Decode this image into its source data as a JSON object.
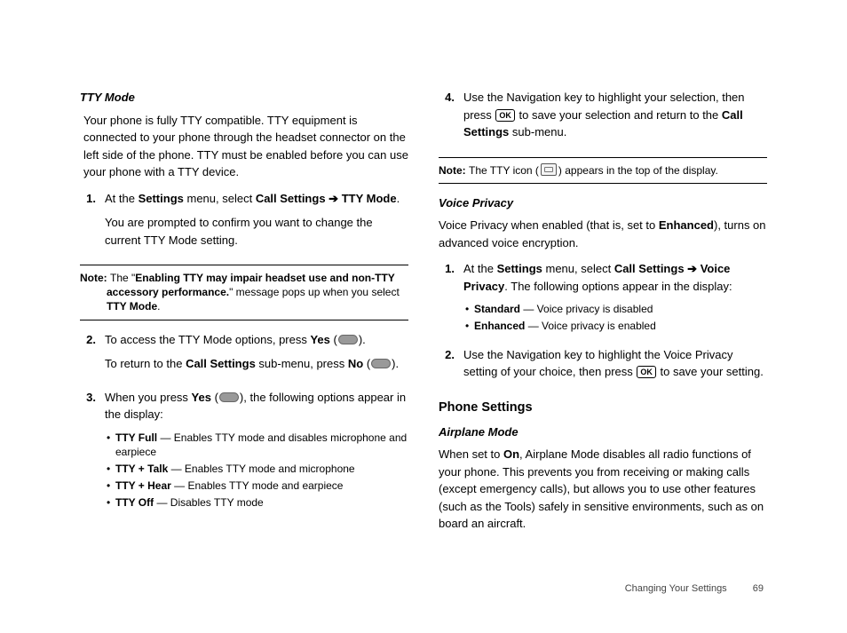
{
  "left": {
    "h_tty": "TTY Mode",
    "p_intro": "Your phone is fully TTY compatible. TTY equipment is connected to your phone through the headset connector on the left side of the phone. TTY must be enabled before you can use your phone with a TTY device.",
    "s1_a": "At the ",
    "s1_b": "Settings",
    "s1_c": " menu, select ",
    "s1_d": "Call Settings",
    "s1_arrow": " ➔ ",
    "s1_e": "TTY Mode",
    "s1_f": ".",
    "s1_line2": "You are prompted to confirm you want to change the current TTY Mode setting.",
    "note1_label": "Note: ",
    "note1_a": "The \"",
    "note1_b": "Enabling TTY may impair headset use and non-TTY accessory performance.",
    "note1_c": "\" message pops up when you select ",
    "note1_d": "TTY Mode",
    "note1_e": ".",
    "s2_a": "To access the TTY Mode options, press ",
    "s2_b": "Yes",
    "s2_c": " (",
    "s2_d": ").",
    "s2_line2_a": "To return to the ",
    "s2_line2_b": "Call Settings",
    "s2_line2_c": " sub-menu, press ",
    "s2_line2_d": "No",
    "s2_line2_e": " (",
    "s2_line2_f": ").",
    "s3_a": "When you press ",
    "s3_b": "Yes",
    "s3_c": " (",
    "s3_d": "), the following options appear in the display:",
    "b1_a": "TTY Full",
    "b1_b": " — Enables TTY mode and disables microphone and earpiece",
    "b2_a": "TTY + Talk",
    "b2_b": " — Enables TTY mode and microphone",
    "b3_a": "TTY + Hear",
    "b3_b": " — Enables TTY mode and earpiece",
    "b4_a": "TTY Off",
    "b4_b": " — Disables TTY mode"
  },
  "right": {
    "s4_a": "Use the Navigation key to highlight your selection, then press ",
    "s4_b": " to save your selection and return to the ",
    "s4_c": "Call Settings",
    "s4_d": " sub-menu.",
    "note2_label": "Note: ",
    "note2_a": "The TTY icon (",
    "note2_b": ") appears in the top of the display.",
    "h_vp": "Voice Privacy",
    "vp_intro_a": "Voice Privacy when enabled (that is, set to ",
    "vp_intro_b": "Enhanced",
    "vp_intro_c": "), turns on advanced voice encryption.",
    "vps1_a": "At the ",
    "vps1_b": "Settings",
    "vps1_c": " menu, select ",
    "vps1_d": "Call Settings",
    "vps1_arrow": " ➔ ",
    "vps1_e": "Voice Privacy",
    "vps1_f": ". The following options appear in the display:",
    "vpb1_a": "Standard",
    "vpb1_b": " — Voice privacy is disabled",
    "vpb2_a": "Enhanced",
    "vpb2_b": " — Voice privacy is enabled",
    "vps2_a": "Use the Navigation key to highlight the Voice Privacy setting of your choice, then press ",
    "vps2_b": " to save your setting.",
    "h_phone": "Phone Settings",
    "h_air": "Airplane Mode",
    "air_a": "When set to ",
    "air_b": "On",
    "air_c": ", Airplane Mode disables all radio functions of your phone. This prevents you from receiving or making calls (except emergency calls), but allows you to use other features (such as the Tools) safely in sensitive environments, such as on board an aircraft."
  },
  "ok_label": "OK",
  "footer_section": "Changing Your Settings",
  "footer_page": "69",
  "nums": {
    "n1": "1.",
    "n2": "2.",
    "n3": "3.",
    "n4": "4."
  }
}
